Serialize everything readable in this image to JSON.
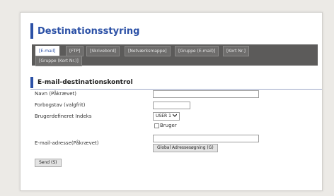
{
  "page": {
    "title": "Destinationsstyring",
    "section_title": "E-mail-destinationskontrol"
  },
  "tabs": [
    {
      "label": "[E-mail]",
      "active": true
    },
    {
      "label": "[FTP]"
    },
    {
      "label": "[Skrivebord]"
    },
    {
      "label": "[Netværksmappe]"
    },
    {
      "label": "[Gruppe (E-mail)]"
    },
    {
      "label": "[Kort Nr.]"
    },
    {
      "label": "[Gruppe (Kort Nr.)]"
    }
  ],
  "form": {
    "name_label": "Navn (Påkrævet)",
    "name_value": "",
    "initial_label": "Forbogstav (valgfrit)",
    "initial_value": "",
    "index_label": "Brugerdefineret Indeks",
    "index_selected": "USER 1",
    "user_checkbox_label": "Bruger",
    "email_label": "E-mail-adresse(Påkrævet)",
    "email_value": "",
    "global_search_button": "Global  Adressesøgning (G)",
    "send_button": "Send (S)"
  },
  "icons": {
    "select_arrow": "chevron-down-icon"
  },
  "colors": {
    "accent": "#2b50a6",
    "tab_bar": "#5c5b5a"
  }
}
